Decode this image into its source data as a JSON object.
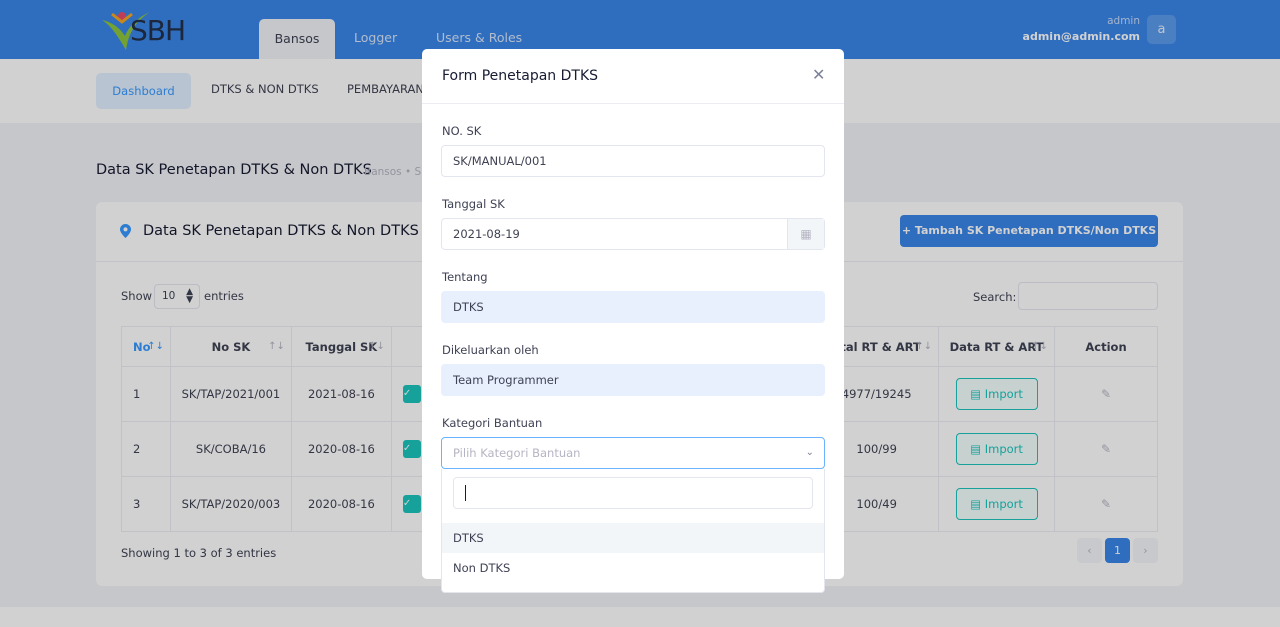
{
  "header": {
    "logo_text": "SBH",
    "tabs": [
      {
        "label": "Bansos"
      },
      {
        "label": "Logger"
      },
      {
        "label": "Users & Roles"
      }
    ],
    "user": {
      "name": "admin",
      "email": "admin@admin.com",
      "avatar_letter": "a"
    }
  },
  "subnav": {
    "items": [
      {
        "label": "Dashboard"
      },
      {
        "label": "DTKS & NON DTKS"
      },
      {
        "label": "PEMBAYARAN"
      }
    ]
  },
  "page": {
    "title": "Data SK Penetapan DTKS & Non DTKS",
    "breadcrumb": "Bansos  •  S"
  },
  "card": {
    "title": "Data SK Penetapan DTKS & Non DTKS",
    "add_button": "+  Tambah SK Penetapan DTKS/Non DTKS",
    "show_label": "Show",
    "show_value": "10",
    "entries_label": "entries",
    "search_label": "Search:",
    "columns": {
      "no": "No",
      "no_sk": "No SK",
      "tanggal_sk": "Tanggal SK",
      "total": "otal RT & ART",
      "data": "Data RT & ART",
      "action": "Action"
    },
    "rows": [
      {
        "no": "1",
        "no_sk": "SK/TAP/2021/001",
        "tanggal": "2021-08-16",
        "total": "4977/19245",
        "import": "Import"
      },
      {
        "no": "2",
        "no_sk": "SK/COBA/16",
        "tanggal": "2020-08-16",
        "total": "100/99",
        "import": "Import"
      },
      {
        "no": "3",
        "no_sk": "SK/TAP/2020/003",
        "tanggal": "2020-08-16",
        "total": "100/49",
        "import": "Import"
      }
    ],
    "footer_text": "Showing 1 to 3 of 3 entries",
    "current_page": "1"
  },
  "modal": {
    "title": "Form Penetapan DTKS",
    "fields": {
      "no_sk": {
        "label": "NO. SK",
        "value": "SK/MANUAL/001"
      },
      "tanggal_sk": {
        "label": "Tanggal SK",
        "value": "2021-08-19"
      },
      "tentang": {
        "label": "Tentang",
        "value": "DTKS"
      },
      "dikeluarkan": {
        "label": "Dikeluarkan oleh",
        "value": "Team Programmer"
      },
      "kategori": {
        "label": "Kategori Bantuan",
        "placeholder": "Pilih Kategori Bantuan"
      }
    },
    "dropdown": {
      "options": [
        {
          "label": "DTKS"
        },
        {
          "label": "Non DTKS"
        }
      ]
    }
  },
  "colors": {
    "primary": "#3a86ea",
    "success": "#1bc5bd",
    "info_light": "#e1f0ff"
  }
}
